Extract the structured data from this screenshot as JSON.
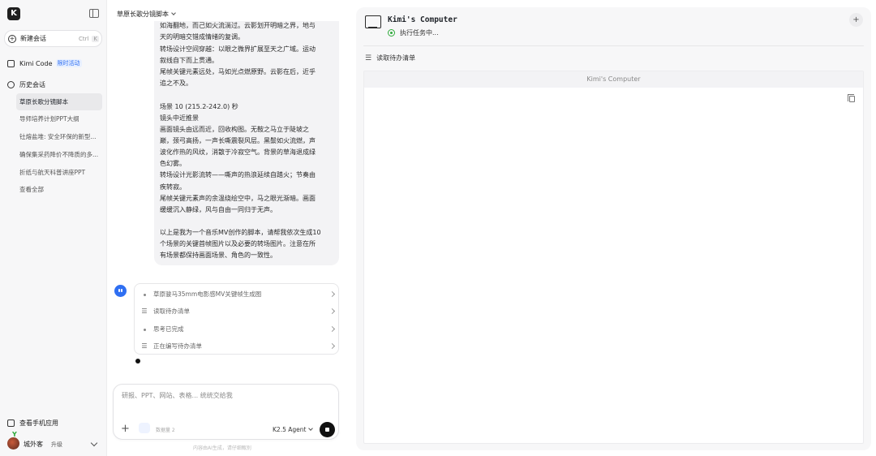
{
  "sidebar": {
    "logo": "K",
    "new_chat": {
      "label": "新建会话",
      "kbd": [
        "Ctrl",
        "K"
      ]
    },
    "kimi_code": {
      "label": "Kimi Code",
      "badge": "限时活动"
    },
    "history_title": "历史会话",
    "history": [
      "草原长歌分镜脚本",
      "导师培养计划PPT大纲",
      "钍熔盐堆: 安全环保的新型...",
      "确保集采药降价不降质的多...",
      "折纸与航天科普讲座PPT",
      "查看全部"
    ],
    "mobile_app": "查看手机应用",
    "user": {
      "name": "城外客",
      "upgrade": "升级"
    }
  },
  "chat": {
    "title": "草原长歌分镜脚本",
    "message_lines": [
      "如海翻地，而己如火流淌过。云影划开明暗之界，地与",
      "天的明暗交错成情绪的复调。",
      "转场设计空间穿越：以眼之微界扩展至天之广域。运动",
      "叙线自下而上贯通。",
      "尾帧关键元素远处，马如光点燃原野。云影在后，近乎",
      "追之不及。",
      "",
      "场景 10 (215.2-242.0) 秒",
      "镜头中近推景",
      "画面镜头由远而近，回收构图。无鞍之马立于陡坡之",
      "巅，颈弓高扬，一声长嘶震裂风层。黑鬃如火流燃，声",
      "波化作热的风纹，消散于冷寂空气。背景的草海退成绿",
      "色幻雾。",
      "转场设计光影流转——嘶声的热浪延续自踏火；节奏由",
      "疾转寂。",
      "尾帧关键元素声的余温绕绘空中，马之眼光渐暗。画面",
      "缓缓沉入静绿，风与自由一同归于无声。",
      "",
      "以上是我为一个音乐MV创作的脚本，请帮我依次生成10",
      "个场景的关键首帧图片以及必要的转场图片。注意在所",
      "有场景都保持画面场景、角色的一致性。"
    ],
    "steps": [
      "草原骏马35mm电影感MV关键帧生成图",
      "读取待办清单",
      "思考已完成",
      "正在编写待办清单"
    ],
    "composer": {
      "placeholder": "研报、PPT、网站、表格... 统统交给我",
      "tool_label": "数据量 2",
      "model": "K2.5 Agent"
    },
    "disclaimer": "内容由AI生成，请仔细甄别"
  },
  "computer": {
    "title": "Kimi's Computer",
    "status": "执行任务中...",
    "todo_label": "读取待办清单",
    "frame_title": "Kimi's Computer"
  }
}
